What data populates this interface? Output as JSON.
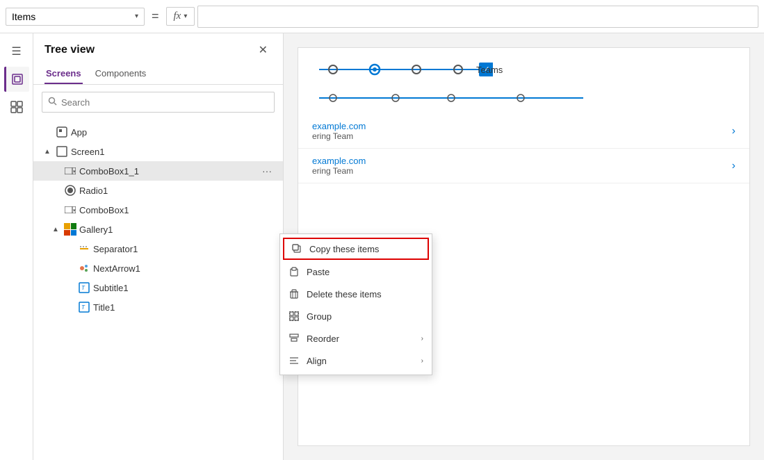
{
  "topbar": {
    "items_label": "Items",
    "equals": "=",
    "fx_label": "fx"
  },
  "tree_view": {
    "title": "Tree view",
    "tabs": [
      "Screens",
      "Components"
    ],
    "active_tab": "Screens",
    "search_placeholder": "Search",
    "items": [
      {
        "id": "app",
        "label": "App",
        "indent": 0,
        "icon": "app",
        "collapse": null
      },
      {
        "id": "screen1",
        "label": "Screen1",
        "indent": 0,
        "icon": "screen",
        "collapse": "▲"
      },
      {
        "id": "combobox1_1",
        "label": "ComboBox1_1",
        "indent": 1,
        "icon": "combobox",
        "collapse": null,
        "selected": true
      },
      {
        "id": "radio1",
        "label": "Radio1",
        "indent": 1,
        "icon": "radio",
        "collapse": null
      },
      {
        "id": "combobox1",
        "label": "ComboBox1",
        "indent": 1,
        "icon": "combobox",
        "collapse": null
      },
      {
        "id": "gallery1",
        "label": "Gallery1",
        "indent": 1,
        "icon": "gallery",
        "collapse": "▲"
      },
      {
        "id": "separator1",
        "label": "Separator1",
        "indent": 2,
        "icon": "separator",
        "collapse": null
      },
      {
        "id": "nextarrow1",
        "label": "NextArrow1",
        "indent": 2,
        "icon": "nextarrow",
        "collapse": null
      },
      {
        "id": "subtitle1",
        "label": "Subtitle1",
        "indent": 2,
        "icon": "text",
        "collapse": null
      },
      {
        "id": "title1",
        "label": "Title1",
        "indent": 2,
        "icon": "text",
        "collapse": null
      }
    ]
  },
  "context_menu": {
    "items": [
      {
        "id": "copy",
        "label": "Copy these items",
        "icon": "copy",
        "highlighted": true
      },
      {
        "id": "paste",
        "label": "Paste",
        "icon": "paste",
        "highlighted": false
      },
      {
        "id": "delete",
        "label": "Delete these items",
        "icon": "delete",
        "highlighted": false
      },
      {
        "id": "group",
        "label": "Group",
        "icon": "group",
        "highlighted": false
      },
      {
        "id": "reorder",
        "label": "Reorder",
        "icon": "reorder",
        "highlighted": false,
        "submenu": true
      },
      {
        "id": "align",
        "label": "Align",
        "icon": "align",
        "highlighted": false,
        "submenu": true
      }
    ]
  },
  "canvas": {
    "teams_label": "Teams",
    "list_items": [
      {
        "id": 1,
        "title": "example.com",
        "subtitle": "ering Team"
      },
      {
        "id": 2,
        "title": "example.com",
        "subtitle": "ering Team"
      }
    ]
  },
  "sidebar_icons": [
    {
      "id": "hamburger",
      "icon": "☰"
    },
    {
      "id": "layers",
      "icon": "◫",
      "active": true
    },
    {
      "id": "components",
      "icon": "⊞"
    }
  ]
}
